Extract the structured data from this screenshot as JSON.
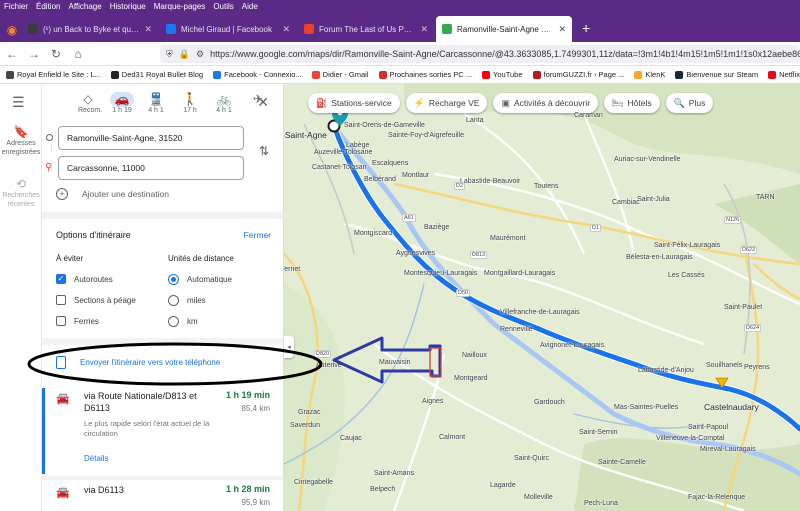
{
  "browser": {
    "menu": [
      "Fichier",
      "Édition",
      "Affichage",
      "Historique",
      "Marque-pages",
      "Outils",
      "Aide"
    ],
    "tabs": [
      {
        "title": "(¹) un Back to Byke et quelques",
        "color": "#3b3b3b",
        "active": false
      },
      {
        "title": "Michel Giraud | Facebook",
        "color": "#1877f2",
        "active": false
      },
      {
        "title": "Forum The Last of Us Part I - jeu",
        "color": "#e8412b",
        "active": false
      },
      {
        "title": "Ramonville-Saint-Agne à Carca",
        "color": "#34a853",
        "active": true
      }
    ],
    "url": "https://www.google.com/maps/dir/Ramonville-Saint-Agne/Carcassonne/@43.3633085,1.7499301,11z/data=!3m1!4b1!4m15!1m5!1m1!1s0x12aebe86612d",
    "bookmarks": [
      {
        "label": "Royal Enfield le Site : L...",
        "color": "#444"
      },
      {
        "label": "Ded31 Royal Bullet Blog",
        "color": "#222"
      },
      {
        "label": "Facebook - Connexio...",
        "color": "#1877f2"
      },
      {
        "label": "Didier - Gmail",
        "color": "#ea4335"
      },
      {
        "label": "Prochaines sorties PC ...",
        "color": "#d32f2f"
      },
      {
        "label": "YouTube",
        "color": "#ff0000"
      },
      {
        "label": "forumGUZZI.fr › Page ...",
        "color": "#b71c1c"
      },
      {
        "label": "KlenK",
        "color": "#f9a825"
      },
      {
        "label": "Bienvenue sur Steam",
        "color": "#1b2838"
      },
      {
        "label": "Netflix",
        "color": "#e50914"
      },
      {
        "label": "WhatsApp",
        "color": "#25d366"
      }
    ]
  },
  "rail": {
    "saved_label": "Adresses enregistrées",
    "recent_label": "Recherches récentes"
  },
  "directions": {
    "modes": [
      {
        "label": "Recom.",
        "icon": "◇",
        "active": false
      },
      {
        "label": "1 h 19",
        "icon": "🚗",
        "active": true
      },
      {
        "label": "4 h 1",
        "icon": "🚆",
        "active": false
      },
      {
        "label": "17 h",
        "icon": "🚶",
        "active": false
      },
      {
        "label": "4 h 1",
        "icon": "🚲",
        "active": false
      },
      {
        "label": "",
        "icon": "✈",
        "active": false
      }
    ],
    "origin": "Ramonville-Saint-Agne, 31520",
    "destination": "Carcassonne, 11000",
    "add_destination": "Ajouter une destination"
  },
  "options": {
    "title": "Options d'itinéraire",
    "close": "Fermer",
    "avoid_header": "À éviter",
    "units_header": "Unités de distance",
    "avoid": [
      {
        "label": "Autoroutes",
        "checked": true
      },
      {
        "label": "Sections à péage",
        "checked": false
      },
      {
        "label": "Ferries",
        "checked": false
      }
    ],
    "units": [
      {
        "label": "Automatique",
        "checked": true
      },
      {
        "label": "miles",
        "checked": false
      },
      {
        "label": "km",
        "checked": false
      }
    ]
  },
  "send_to_phone": "Envoyer l'itinéraire vers votre téléphone",
  "routes": [
    {
      "via": "via Route Nationale/D813 et D6113",
      "duration": "1 h 19 min",
      "distance": "85,4 km",
      "description": "Le plus rapide selon l'état actuel de la circulation",
      "details": "Détails",
      "selected": true
    },
    {
      "via": "via D6113",
      "duration": "1 h 28 min",
      "distance": "95,9 km",
      "description": "",
      "details": "",
      "selected": false
    }
  ],
  "map": {
    "chips": [
      {
        "label": "Stations-service",
        "icon": "⛽"
      },
      {
        "label": "Recharge VE",
        "icon": "⚡"
      },
      {
        "label": "Activités à découvrir",
        "icon": "▣"
      },
      {
        "label": "Hôtels",
        "icon": "🛏"
      },
      {
        "label": "Plus",
        "icon": "🔍"
      }
    ],
    "towns": [
      {
        "label": "-Saint-Agne",
        "big": true
      },
      {
        "label": "Saint-Orens-de-Gameville"
      },
      {
        "label": "Auzeville-Tolosane"
      },
      {
        "label": "Castanet-Tolosan"
      },
      {
        "label": "Labège"
      },
      {
        "label": "Sainte-Foy-d'Aigrefeuille"
      },
      {
        "label": "Lanta"
      },
      {
        "label": "Caraman"
      },
      {
        "label": "Auriac-sur-Vendinelle"
      },
      {
        "label": "Escalquens"
      },
      {
        "label": "Belbérand"
      },
      {
        "label": "Montlaur"
      },
      {
        "label": "Labastide-Beauvoir"
      },
      {
        "label": "Toutens"
      },
      {
        "label": "Saint-Julia"
      },
      {
        "label": "Cambiac"
      },
      {
        "label": "Montgiscard"
      },
      {
        "label": "Baziège"
      },
      {
        "label": "Ayguesvives"
      },
      {
        "label": "Maurémont"
      },
      {
        "label": "Saint-Félix-Lauragais"
      },
      {
        "label": "Montesquieu-Lauragais"
      },
      {
        "label": "Montgaillard-Lauragais"
      },
      {
        "label": "Bélesta-en-Lauragais"
      },
      {
        "label": "Les Cassés"
      },
      {
        "label": "Saint-Paulet"
      },
      {
        "label": "Villefranche-de-Lauragais"
      },
      {
        "label": "Renneville"
      },
      {
        "label": "Avignonet-Lauragais"
      },
      {
        "label": "Mauvaisin"
      },
      {
        "label": "Nailloux"
      },
      {
        "label": "Montgeard"
      },
      {
        "label": "Labastide-d'Anjou"
      },
      {
        "label": "Souilhanels"
      },
      {
        "label": "Peyrens"
      },
      {
        "label": "Castelnaudary",
        "big": true
      },
      {
        "label": "Mas-Saintes-Puelles"
      },
      {
        "label": "Saint-Papoul"
      },
      {
        "label": "Gardouch"
      },
      {
        "label": "Aignes"
      },
      {
        "label": "Calmont"
      },
      {
        "label": "Grazac"
      },
      {
        "label": "Caujac"
      },
      {
        "label": "Saint-Quirc"
      },
      {
        "label": "Saint-Sernin"
      },
      {
        "label": "Saverdun"
      },
      {
        "label": "Villeneuve-la-Comptal"
      },
      {
        "label": "Mireval-Lauragais"
      },
      {
        "label": "Sainte-Camelle"
      },
      {
        "label": "Saint-Amans"
      },
      {
        "label": "Belpech"
      },
      {
        "label": "Molleville"
      },
      {
        "label": "Cintegabelle"
      },
      {
        "label": "Vernet"
      },
      {
        "label": "Auterive"
      },
      {
        "label": "Lagarde"
      },
      {
        "label": "Pech-Luna"
      },
      {
        "label": "Fajac-la-Relenque"
      },
      {
        "label": "TARN"
      }
    ],
    "roads": [
      "A61",
      "D2",
      "D813",
      "D622",
      "N126",
      "D1",
      "D624",
      "D820",
      "D50"
    ]
  },
  "colors": {
    "route_primary": "#1a73e8",
    "route_alt": "#a8c7f5",
    "annotation": "#000000",
    "arrow": "#2c3aa8"
  }
}
